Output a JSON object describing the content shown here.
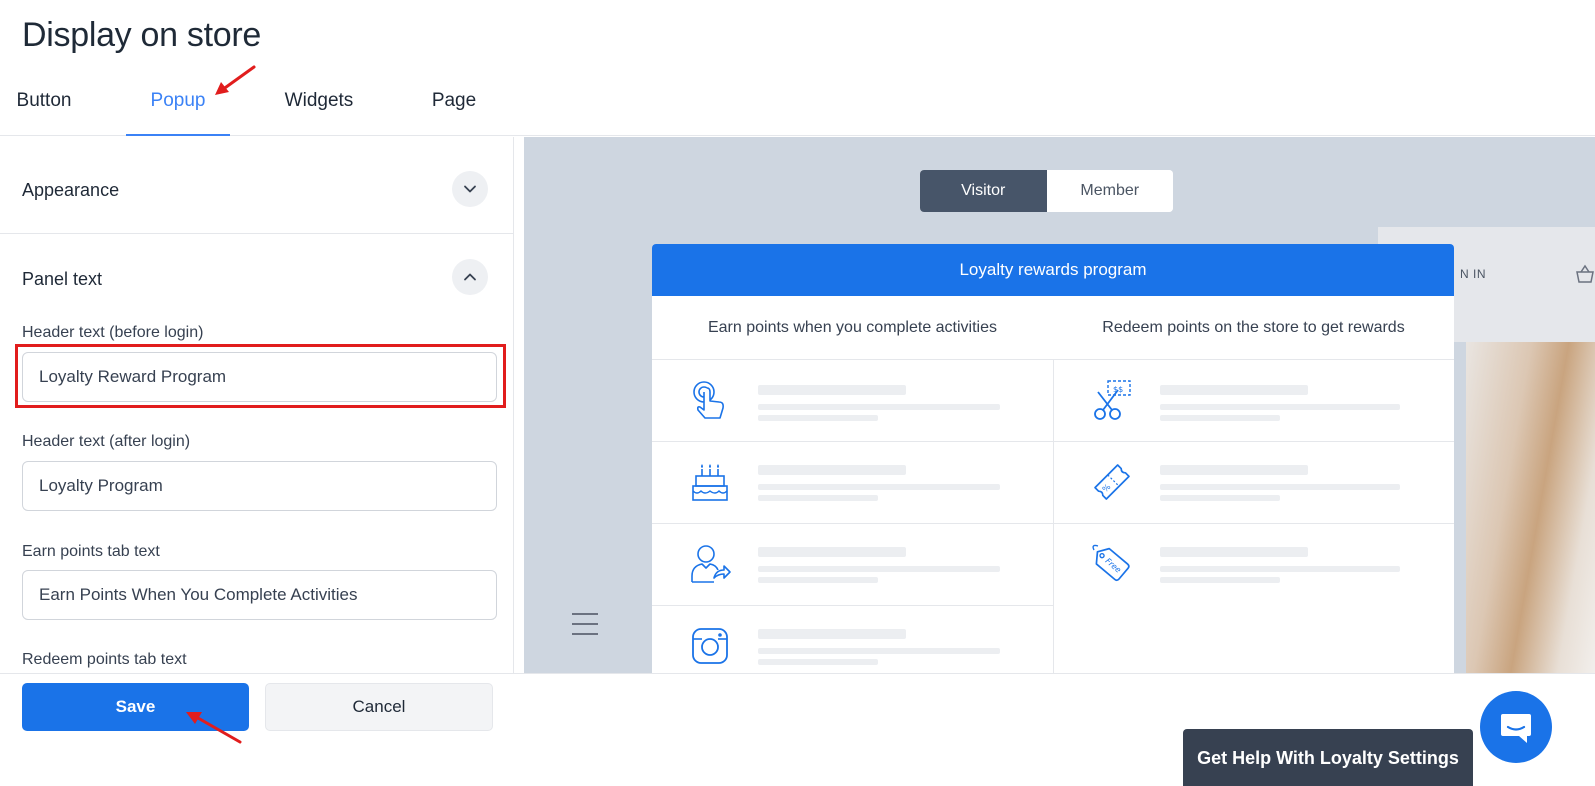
{
  "page_title": "Display on store",
  "tabs": [
    {
      "label": "Button"
    },
    {
      "label": "Popup"
    },
    {
      "label": "Widgets"
    },
    {
      "label": "Page"
    }
  ],
  "sections": {
    "appearance": "Appearance",
    "panel_text": "Panel text"
  },
  "fields": {
    "header_before": {
      "label": "Header text (before login)",
      "value": "Loyalty Reward Program"
    },
    "header_after": {
      "label": "Header text (after login)",
      "value": "Loyalty Program"
    },
    "earn_tab": {
      "label": "Earn points tab text",
      "value": "Earn Points When You Complete Activities"
    },
    "redeem_tab": {
      "label": "Redeem points tab text"
    }
  },
  "preview": {
    "toggle": {
      "visitor": "Visitor",
      "member": "Member"
    },
    "store_signin": "N IN",
    "popup": {
      "header": "Loyalty rewards program",
      "earn_tab": "Earn points when you complete activities",
      "redeem_tab": "Redeem points on the store to get rewards",
      "earn_icons": [
        "tap-icon",
        "birthday-cake-icon",
        "refer-user-icon",
        "instagram-icon"
      ],
      "redeem_icons": [
        "coupon-scissors-icon",
        "discount-ticket-icon",
        "free-tag-icon"
      ]
    }
  },
  "actions": {
    "save": "Save",
    "cancel": "Cancel",
    "help": "Get Help With Loyalty Settings"
  },
  "colors": {
    "primary": "#1a73e8",
    "tab_active": "#3b82f6",
    "annotation_red": "#e11d1d",
    "toggle_active": "#475569"
  }
}
